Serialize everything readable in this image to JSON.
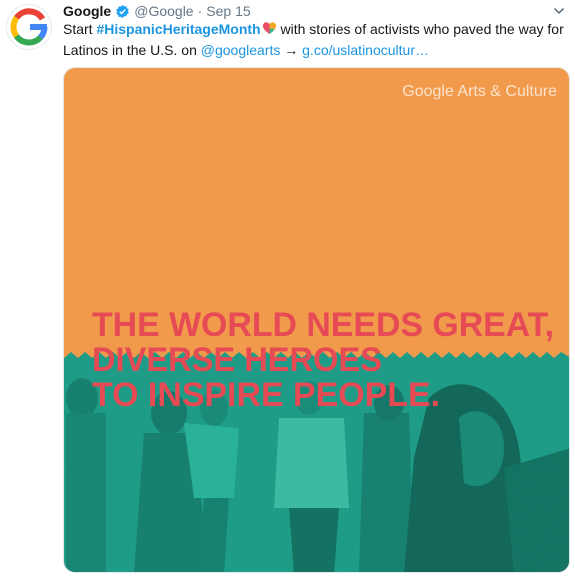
{
  "tweet": {
    "author_name": "Google",
    "handle": "@Google",
    "separator": "·",
    "timestamp": "Sep 15",
    "text": {
      "line1_prefix": "Start ",
      "hashtag": "#HispanicHeritageMonth",
      "line1_suffix": " with stories of activists who paved the way for",
      "line2_prefix": "Latinos in the U.S. on ",
      "mention": "@googlearts",
      "arrow": " → ",
      "link": "g.co/uslatinocultur…"
    },
    "icons": {
      "avatar": "google-logo-icon",
      "verified": "verified-badge-icon",
      "caret": "chevron-down-icon",
      "emoji": "heart-emoji-icon"
    }
  },
  "media": {
    "brand": "Google Arts & Culture",
    "headline_lines": [
      "THE WORLD NEEDS GREAT,",
      "DIVERSE HEROES",
      "TO INSPIRE PEOPLE."
    ],
    "colors": {
      "top": "#f39b4d",
      "bottom": "#1e9c87",
      "headline": "#e64a55",
      "brand": "#fbe3cd"
    }
  }
}
